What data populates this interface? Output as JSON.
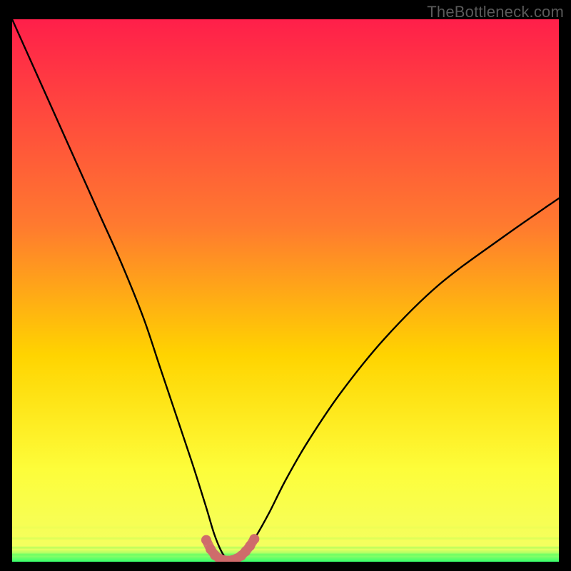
{
  "watermark": "TheBottleneck.com",
  "colors": {
    "background": "#000000",
    "grad_top": "#ff1f4a",
    "grad_mid1": "#ff7a2f",
    "grad_mid2": "#ffd400",
    "grad_mid3": "#fdfd3a",
    "grad_green": "#36ff6c",
    "curve": "#000000",
    "marker_stroke": "#c86060",
    "marker_fill": "#cf6b6b"
  },
  "chart_data": {
    "type": "line",
    "title": "",
    "xlabel": "",
    "ylabel": "",
    "xlim": [
      0,
      100
    ],
    "ylim": [
      0,
      100
    ],
    "series": [
      {
        "name": "bottleneck-curve",
        "x": [
          0,
          4,
          8,
          12,
          16,
          20,
          24,
          27,
          30,
          33,
          35.5,
          37,
          38.5,
          39.8,
          41,
          42.5,
          44.5,
          47,
          50,
          54,
          60,
          68,
          78,
          90,
          100
        ],
        "y": [
          100,
          91,
          82,
          73,
          64,
          55,
          45,
          36,
          27,
          18,
          10,
          5,
          1.5,
          0.2,
          0.2,
          1.4,
          4.5,
          9,
          15,
          22,
          31,
          41,
          51,
          60,
          67
        ]
      }
    ],
    "markers": {
      "name": "highlight-band",
      "x": [
        35.5,
        36.3,
        37.1,
        37.9,
        38.7,
        39.5,
        40.3,
        41.1,
        41.9,
        42.7,
        43.5,
        44.3
      ],
      "y": [
        4.0,
        2.3,
        1.2,
        0.6,
        0.3,
        0.2,
        0.3,
        0.6,
        1.1,
        1.9,
        2.9,
        4.2
      ]
    }
  }
}
